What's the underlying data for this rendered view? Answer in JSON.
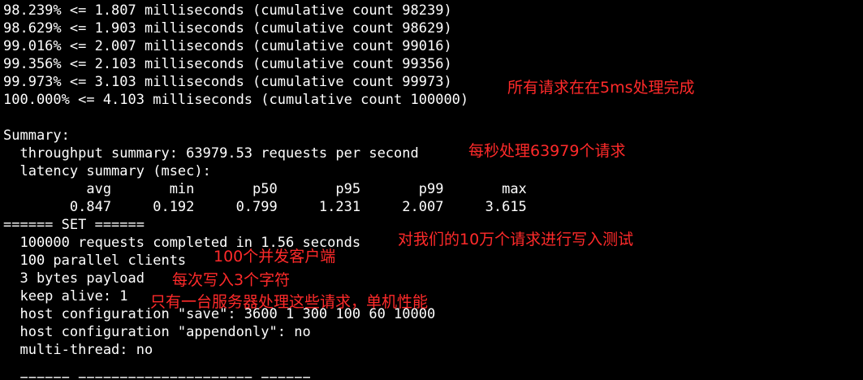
{
  "terminal": {
    "background": "#000000",
    "text_color": "#ffffff",
    "annotation_color": "#ff2a2a",
    "lines": [
      "98.239% <= 1.807 milliseconds (cumulative count 98239)",
      "98.629% <= 1.903 milliseconds (cumulative count 98629)",
      "99.016% <= 2.007 milliseconds (cumulative count 99016)",
      "99.356% <= 2.103 milliseconds (cumulative count 99356)",
      "99.973% <= 3.103 milliseconds (cumulative count 99973)",
      "100.000% <= 4.103 milliseconds (cumulative count 100000)",
      "",
      "Summary:",
      "  throughput summary: 63979.53 requests per second",
      "  latency summary (msec):",
      "          avg       min       p50       p95       p99       max",
      "        0.847     0.192     0.799     1.231     2.007     3.615",
      "====== SET ======",
      "  100000 requests completed in 1.56 seconds",
      "  100 parallel clients",
      "  3 bytes payload",
      "  keep alive: 1",
      "  host configuration \"save\": 3600 1 300 100 60 10000",
      "  host configuration \"appendonly\": no",
      "  multi-thread: no",
      "",
      "  ====== ===================== ======"
    ],
    "annotations": [
      "所有请求在在5ms处理完成",
      "每秒处理63979个请求",
      "对我们的10万个请求进行写入测试",
      "100个并发客户端",
      "每次写入3个字符",
      "只有一台服务器处理这些请求，单机性能"
    ]
  }
}
